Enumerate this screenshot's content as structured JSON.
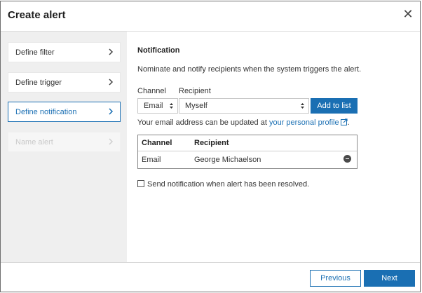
{
  "dialog": {
    "title": "Create alert",
    "close_icon": "close-icon"
  },
  "steps": [
    {
      "label": "Define filter",
      "state": "normal"
    },
    {
      "label": "Define trigger",
      "state": "normal"
    },
    {
      "label": "Define notification",
      "state": "active"
    },
    {
      "label": "Name alert",
      "state": "disabled"
    }
  ],
  "notification": {
    "title": "Notification",
    "description": "Nominate and notify recipients when the system triggers the alert.",
    "channel_label": "Channel",
    "recipient_label": "Recipient",
    "channel_value": "Email",
    "recipient_value": "Myself",
    "add_button": "Add to list",
    "email_note_prefix": "Your email address can be updated at ",
    "profile_link": "your personal profile",
    "email_note_suffix": "."
  },
  "table": {
    "headers": [
      "Channel",
      "Recipient"
    ],
    "rows": [
      {
        "channel": "Email",
        "recipient": "George Michaelson"
      }
    ]
  },
  "resolved_checkbox": {
    "label": "Send notification when alert has been resolved.",
    "checked": false
  },
  "footer": {
    "previous": "Previous",
    "next": "Next"
  },
  "colors": {
    "accent": "#1a6fb3",
    "sidebar_bg": "#efefef"
  }
}
